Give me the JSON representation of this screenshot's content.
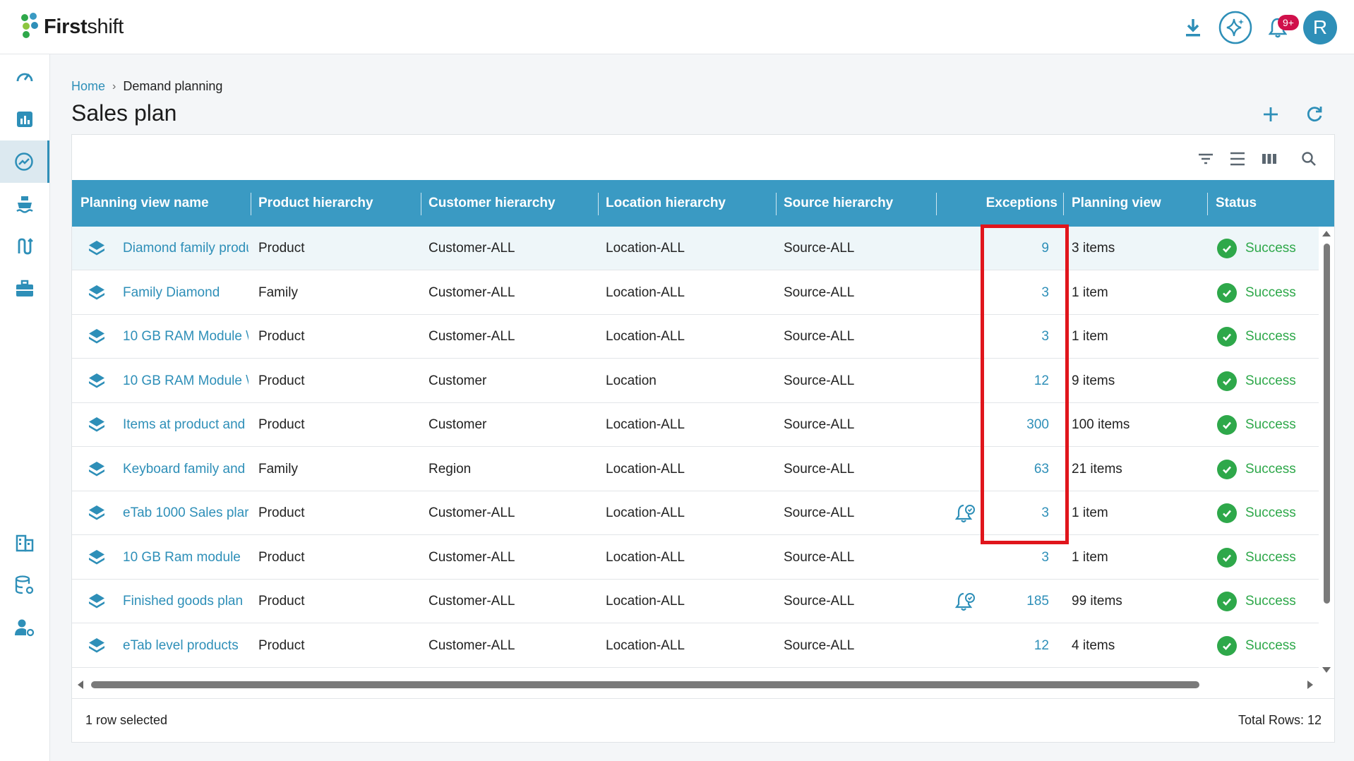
{
  "app": {
    "name_bold": "First",
    "name_light": "shift",
    "notifications_badge": "9+",
    "avatar_initial": "R"
  },
  "breadcrumb": {
    "home": "Home",
    "separator": "›",
    "current": "Demand planning"
  },
  "page": {
    "title": "Sales plan"
  },
  "table": {
    "columns": [
      "Planning view name",
      "Product hierarchy",
      "Customer hierarchy",
      "Location hierarchy",
      "Source hierarchy",
      "",
      "Exceptions",
      "Planning view",
      "Status"
    ],
    "rows": [
      {
        "name": "Diamond family produ",
        "product": "Product",
        "customer": "Customer-ALL",
        "location": "Location-ALL",
        "source": "Source-ALL",
        "alert": false,
        "exceptions": "9",
        "planning_view": "3 items",
        "status": "Success"
      },
      {
        "name": "Family Diamond",
        "product": "Family",
        "customer": "Customer-ALL",
        "location": "Location-ALL",
        "source": "Source-ALL",
        "alert": false,
        "exceptions": "3",
        "planning_view": "1 item",
        "status": "Success"
      },
      {
        "name": "10 GB RAM Module \\",
        "product": "Product",
        "customer": "Customer-ALL",
        "location": "Location-ALL",
        "source": "Source-ALL",
        "alert": false,
        "exceptions": "3",
        "planning_view": "1 item",
        "status": "Success"
      },
      {
        "name": "10 GB RAM Module \\",
        "product": "Product",
        "customer": "Customer",
        "location": "Location",
        "source": "Source-ALL",
        "alert": false,
        "exceptions": "12",
        "planning_view": "9 items",
        "status": "Success"
      },
      {
        "name": "Items at product and",
        "product": "Product",
        "customer": "Customer",
        "location": "Location-ALL",
        "source": "Source-ALL",
        "alert": false,
        "exceptions": "300",
        "planning_view": "100 items",
        "status": "Success"
      },
      {
        "name": "Keyboard family and",
        "product": "Family",
        "customer": "Region",
        "location": "Location-ALL",
        "source": "Source-ALL",
        "alert": false,
        "exceptions": "63",
        "planning_view": "21 items",
        "status": "Success"
      },
      {
        "name": "eTab 1000 Sales plar",
        "product": "Product",
        "customer": "Customer-ALL",
        "location": "Location-ALL",
        "source": "Source-ALL",
        "alert": true,
        "exceptions": "3",
        "planning_view": "1 item",
        "status": "Success"
      },
      {
        "name": "10 GB Ram module",
        "product": "Product",
        "customer": "Customer-ALL",
        "location": "Location-ALL",
        "source": "Source-ALL",
        "alert": false,
        "exceptions": "3",
        "planning_view": "1 item",
        "status": "Success"
      },
      {
        "name": "Finished goods plan",
        "product": "Product",
        "customer": "Customer-ALL",
        "location": "Location-ALL",
        "source": "Source-ALL",
        "alert": true,
        "exceptions": "185",
        "planning_view": "99 items",
        "status": "Success"
      },
      {
        "name": "eTab level products",
        "product": "Product",
        "customer": "Customer-ALL",
        "location": "Location-ALL",
        "source": "Source-ALL",
        "alert": false,
        "exceptions": "12",
        "planning_view": "4 items",
        "status": "Success"
      }
    ]
  },
  "footer": {
    "selection": "1 row selected",
    "total": "Total Rows: 12"
  },
  "colors": {
    "accent": "#2e8fb8",
    "header_bg": "#3a9ac3",
    "success": "#2ea84a",
    "highlight": "#e0151c",
    "badge": "#d0104b"
  },
  "icons": {
    "sidebar": [
      "dashboard-icon",
      "bar-chart-icon",
      "trend-icon",
      "ship-icon",
      "route-icon",
      "briefcase-icon",
      "building-icon",
      "database-settings-icon",
      "user-settings-icon"
    ]
  }
}
